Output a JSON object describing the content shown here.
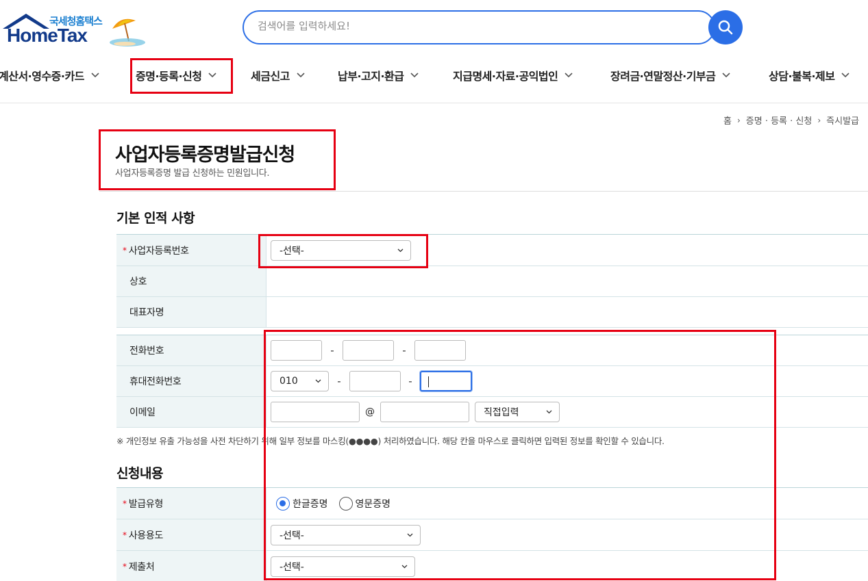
{
  "header": {
    "logo_sub": "국세청홈택스",
    "logo_main": "HomeTax",
    "search_placeholder": "검색어를 입력하세요!"
  },
  "nav": [
    {
      "label": "계산서·영수증·카드"
    },
    {
      "label": "증명·등록·신청"
    },
    {
      "label": "세금신고"
    },
    {
      "label": "납부·고지·환급"
    },
    {
      "label": "지급명세·자료·공익법인"
    },
    {
      "label": "장려금·연말정산·기부금"
    },
    {
      "label": "상담·불복·제보"
    }
  ],
  "breadcrumb": [
    "홈",
    "증명 · 등록 · 신청",
    "즉시발급"
  ],
  "page": {
    "title": "사업자등록증명발급신청",
    "subtitle": "사업자등록증명 발급 신청하는 민원입니다."
  },
  "section_basic": {
    "title": "기본 인적 사항",
    "rows": [
      {
        "label": "사업자등록번호",
        "required": true,
        "select": "-선택-"
      },
      {
        "label": "상호"
      },
      {
        "label": "대표자명"
      }
    ]
  },
  "section_contact": {
    "phone_label": "전화번호",
    "mobile_label": "휴대전화번호",
    "mobile_prefix": "010",
    "email_label": "이메일",
    "email_at": "@",
    "email_domain_select": "직접입력",
    "dash": "-"
  },
  "notice": "※ 개인정보 유출 가능성을 사전 차단하기 위해 일부 정보를 마스킹(●●●●) 처리하였습니다. 해당 칸을 마우스로 클릭하면 입력된 정보를 확인할 수 있습니다.",
  "section_request": {
    "title": "신청내용",
    "issue_type_label": "발급유형",
    "issue_type_options": [
      "한글증명",
      "영문증명"
    ],
    "issue_type_selected": "한글증명",
    "usage_label": "사용용도",
    "usage_select": "-선택-",
    "submit_to_label": "제출처",
    "submit_to_select": "-선택-",
    "required_mark": "*"
  },
  "colors": {
    "accent": "#2b6ee6",
    "highlight_box": "#e60012",
    "label_bg": "#eef5f6"
  }
}
